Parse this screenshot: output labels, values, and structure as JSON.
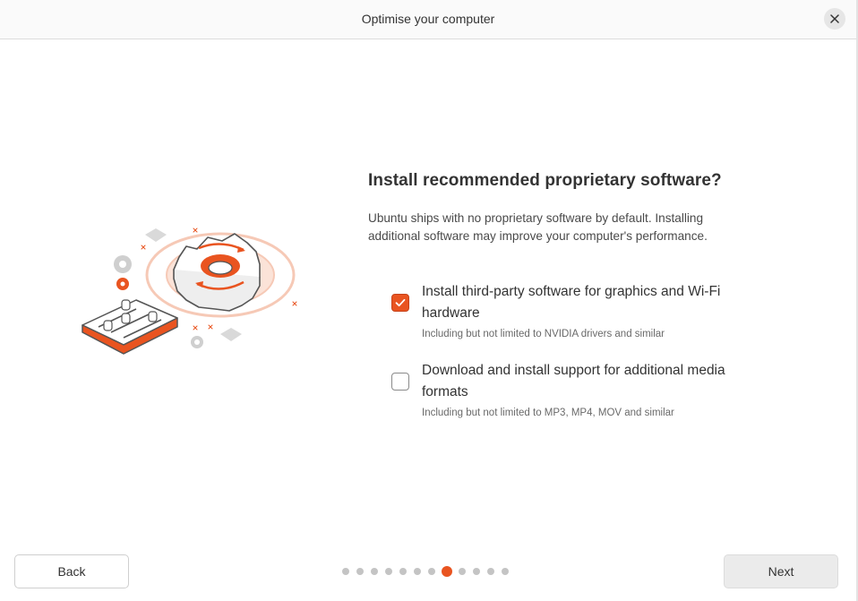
{
  "window": {
    "title": "Optimise your computer"
  },
  "main": {
    "heading": "Install recommended proprietary software?",
    "description": "Ubuntu ships with no proprietary software by default. Installing additional software may improve your computer's performance.",
    "options": [
      {
        "label": "Install third-party software for graphics and Wi-Fi hardware",
        "sublabel": "Including but not limited to NVIDIA drivers and similar",
        "checked": true
      },
      {
        "label": "Download and install support for additional media formats",
        "sublabel": "Including but not limited to MP3, MP4, MOV and similar",
        "checked": false
      }
    ]
  },
  "footer": {
    "back_label": "Back",
    "next_label": "Next",
    "progress": {
      "total_steps": 12,
      "current_step": 8
    }
  },
  "colors": {
    "accent": "#e95420",
    "illustration_gray": "#d4d4d4",
    "illustration_peach": "#f6c9b6"
  },
  "icons": [
    "close-icon",
    "checkmark-icon",
    "gear-illustration"
  ]
}
